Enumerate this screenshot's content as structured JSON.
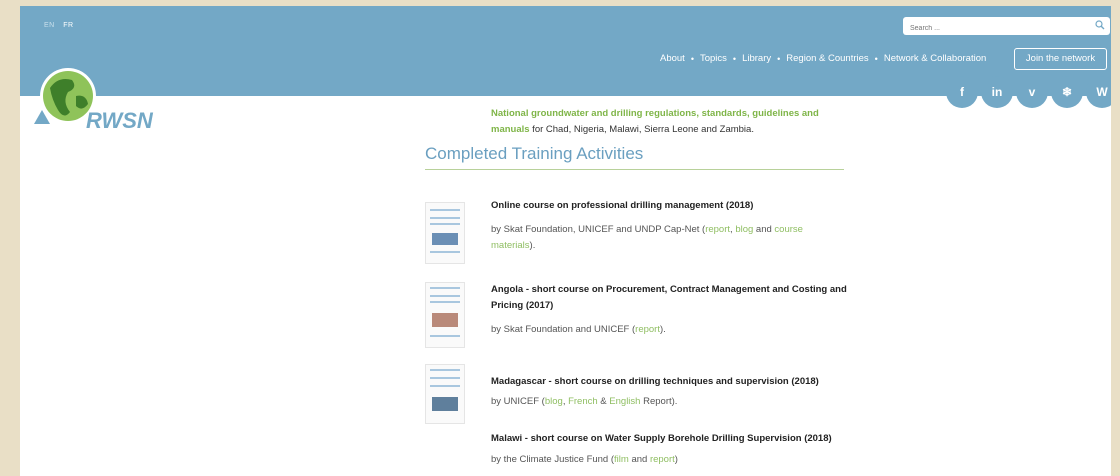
{
  "header": {
    "lang": {
      "en": "EN",
      "fr": "FR"
    },
    "search_placeholder": "Search ...",
    "nav": [
      "About",
      "Topics",
      "Library",
      "Region & Countries",
      "Network & Collaboration"
    ],
    "nav_sep": "•",
    "join_label": "Join the network",
    "social": [
      {
        "icon": "facebook-icon",
        "glyph": "f"
      },
      {
        "icon": "linkedin-icon",
        "glyph": "in"
      },
      {
        "icon": "vimeo-icon",
        "glyph": "v"
      },
      {
        "icon": "snowflake-icon",
        "glyph": "❄"
      },
      {
        "icon": "wordpress-icon",
        "glyph": "W"
      }
    ],
    "logo_text": "RWSN"
  },
  "intro": {
    "highlight": "National groundwater and drilling regulations, standards, guidelines and manuals",
    "rest": " for Chad, Nigeria, Malawi, Sierra Leone and Zambia."
  },
  "section_title": "Completed Training Activities",
  "items": [
    {
      "title": "Online course on professional drilling management (2018)",
      "by_prefix": "by Skat Foundation, UNICEF and UNDP Cap-Net (",
      "links": [
        "report",
        "blog",
        "course materials"
      ],
      "seps": [
        ", ",
        " and "
      ],
      "by_suffix": ")."
    },
    {
      "title": "Angola - short course on Procurement, Contract Management and Costing and Pricing (2017)",
      "by_prefix": "by Skat Foundation and UNICEF (",
      "links": [
        "report"
      ],
      "seps": [],
      "by_suffix": ")."
    },
    {
      "title": "Madagascar - short course on drilling techniques and supervision (2018)",
      "by_prefix": "by UNICEF (",
      "links": [
        "blog",
        "French",
        "English"
      ],
      "seps": [
        ", ",
        " & "
      ],
      "by_suffix": " Report)."
    },
    {
      "title": "Malawi - short course on Water Supply Borehole Drilling Supervision (2018)",
      "by_prefix": "by the Climate Justice Fund (",
      "links": [
        "film",
        "report"
      ],
      "seps": [
        " and "
      ],
      "by_suffix": ")"
    }
  ],
  "colors": {
    "header": "#73a8c6",
    "accent_green": "#7fb548",
    "link_green": "#8fbe62",
    "title_blue": "#6a9fc0"
  }
}
